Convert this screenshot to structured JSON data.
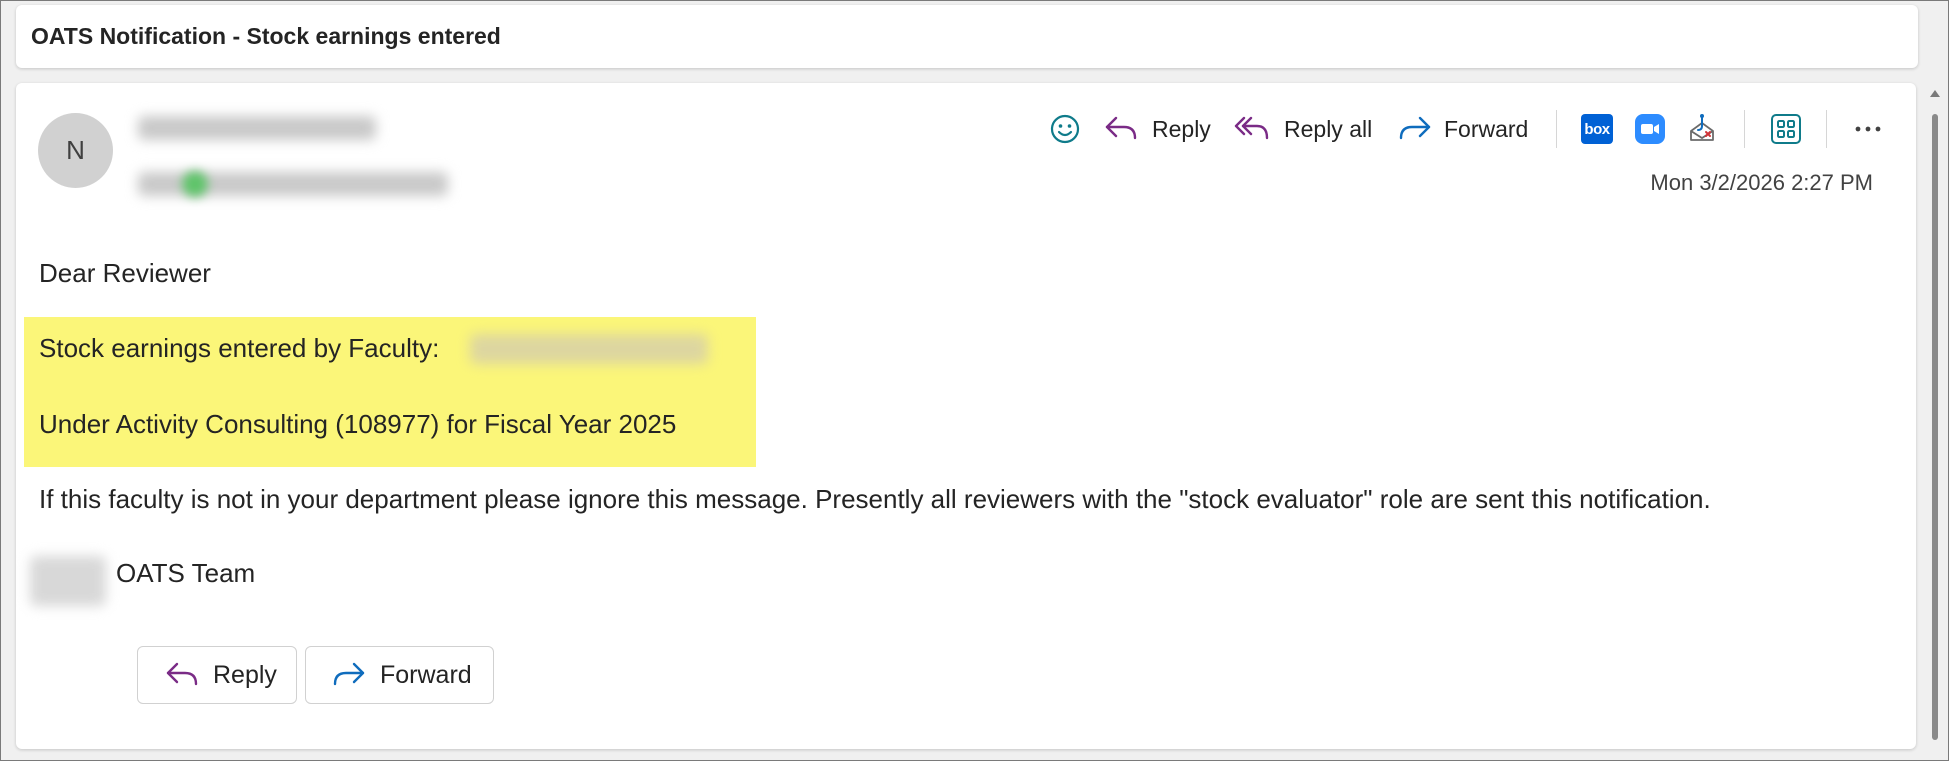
{
  "subject": "OATS Notification - Stock earnings entered",
  "sender": {
    "avatar_initial": "N"
  },
  "toolbar": {
    "reply_label": "Reply",
    "reply_all_label": "Reply all",
    "forward_label": "Forward",
    "box_label": "box"
  },
  "timestamp": "Mon 3/2/2026 2:27 PM",
  "body": {
    "greeting": "Dear Reviewer",
    "line1": "Stock earnings entered by Faculty:",
    "line2": "Under Activity Consulting (108977) for Fiscal Year 2025",
    "notice": "If this faculty is not in your department please ignore this message. Presently all reviewers with the \"stock evaluator\" role are sent this notification.",
    "signoff": "OATS Team"
  },
  "bottom_actions": {
    "reply_label": "Reply",
    "forward_label": "Forward"
  },
  "colors": {
    "highlight": "#fbf679",
    "reply_icon": "#7a2b86",
    "forward_icon": "#0f6cbd",
    "emoji_icon": "#0f7b8a",
    "box_brand": "#0061d5",
    "zoom_brand": "#2d8cff"
  }
}
